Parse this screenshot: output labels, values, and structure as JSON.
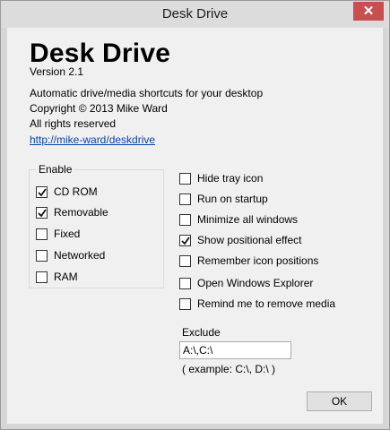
{
  "window": {
    "title": "Desk Drive",
    "close_glyph": "✕"
  },
  "about": {
    "app_title": "Desk Drive",
    "version": "Version 2.1",
    "description": "Automatic drive/media shortcuts for your desktop",
    "copyright": "Copyright © 2013 Mike Ward",
    "rights": "All rights reserved",
    "link": "http://mike-ward/deskdrive"
  },
  "enable": {
    "label": "Enable",
    "items": [
      {
        "label": "CD ROM",
        "checked": true
      },
      {
        "label": "Removable",
        "checked": true
      },
      {
        "label": "Fixed",
        "checked": false
      },
      {
        "label": "Networked",
        "checked": false
      },
      {
        "label": "RAM",
        "checked": false
      }
    ]
  },
  "options": [
    {
      "label": "Hide tray icon",
      "checked": false
    },
    {
      "label": "Run on startup",
      "checked": false
    },
    {
      "label": "Minimize all windows",
      "checked": false
    },
    {
      "label": "Show positional effect",
      "checked": true
    },
    {
      "label": "Remember icon positions",
      "checked": false
    },
    {
      "label": "Open Windows Explorer",
      "checked": false
    },
    {
      "label": "Remind me to remove media",
      "checked": false
    }
  ],
  "exclude": {
    "label": "Exclude",
    "value": "A:\\,C:\\",
    "example": "( example: C:\\, D:\\ )"
  },
  "ok_label": "OK"
}
